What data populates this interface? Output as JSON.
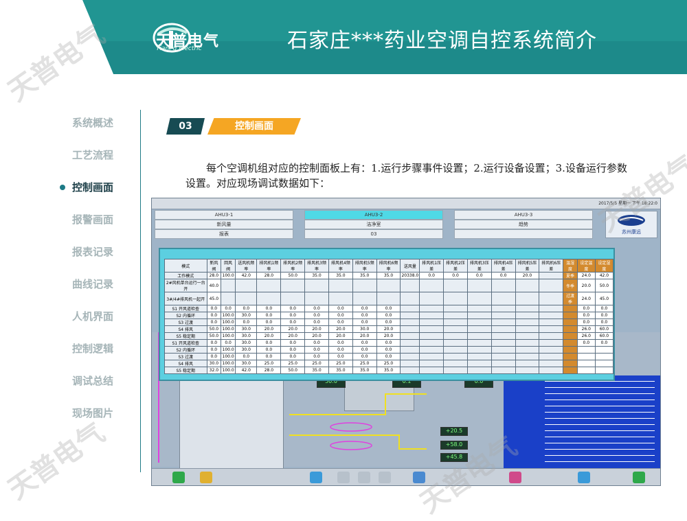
{
  "header": {
    "logo_text": "天普电气",
    "logo_sub": "TianPu Electric",
    "title": "石家庄***药业空调自控系统简介"
  },
  "sidebar": {
    "items": [
      {
        "label": "系统概述",
        "active": false
      },
      {
        "label": "工艺流程",
        "active": false
      },
      {
        "label": "控制画面",
        "active": true
      },
      {
        "label": "报警画面",
        "active": false
      },
      {
        "label": "报表记录",
        "active": false
      },
      {
        "label": "曲线记录",
        "active": false
      },
      {
        "label": "人机界面",
        "active": false
      },
      {
        "label": "控制逻辑",
        "active": false
      },
      {
        "label": "调试总结",
        "active": false
      },
      {
        "label": "现场图片",
        "active": false
      }
    ]
  },
  "section": {
    "number": "03",
    "title": "控制画面"
  },
  "paragraph": "每个空调机组对应的控制面板上有：1.运行步骤事件设置；2.运行设备设置；3.设备运行参数设置。对应现场调试数据如下：",
  "screenshot": {
    "clock": "2017/5/5 星期一 下午 18:22:0",
    "units": [
      "AHU3-1",
      "AHU3-2",
      "AHU3-3"
    ],
    "row2": [
      "新风量",
      "洁净室",
      "趋势"
    ],
    "row3": [
      "报表",
      "03",
      ""
    ],
    "brand": "苏州康远",
    "readouts": [
      "50.0",
      "0.1",
      "0.0"
    ],
    "temps": [
      "+20.5",
      "+58.0",
      "+45.8"
    ],
    "table_header": [
      "模式",
      "新风阀",
      "回风阀",
      "送风机频率",
      "排风机1频率",
      "排风机2频率",
      "排风机3频率",
      "排风机4频率",
      "排风机5频率",
      "排风机6频率",
      "送风量",
      "排风机1压差",
      "排风机2压差",
      "排风机3压差",
      "排风机4压差",
      "排风机5压差",
      "排风机6压差"
    ],
    "table_rows": [
      [
        "工作模式",
        "28.0",
        "100.0",
        "42.0",
        "28.0",
        "50.0",
        "35.0",
        "35.0",
        "35.0",
        "35.0",
        "20338.0",
        "0.0",
        "0.0",
        "0.0",
        "0.0",
        "20.0"
      ],
      [
        "2#风机单台运行一台开",
        "40.0"
      ],
      [
        "3#/4#排风机一起开",
        "45.0"
      ],
      [
        "S1 开风道检查",
        "0.0",
        "0.0",
        "0.0",
        "0.0",
        "0.0",
        "0.0",
        "0.0",
        "0.0",
        "0.0"
      ],
      [
        "S2 内循环",
        "0.0",
        "100.0",
        "30.0",
        "0.0",
        "0.0",
        "0.0",
        "0.0",
        "0.0",
        "0.0"
      ],
      [
        "S3 过渡",
        "0.0",
        "100.0",
        "0.0",
        "0.0",
        "0.0",
        "0.0",
        "0.0",
        "0.0",
        "0.0"
      ],
      [
        "S4 排风",
        "50.0",
        "100.0",
        "30.0",
        "20.0",
        "20.0",
        "20.0",
        "20.0",
        "30.0",
        "20.0"
      ],
      [
        "S5 稳定期",
        "50.0",
        "100.0",
        "30.0",
        "20.0",
        "20.0",
        "20.0",
        "20.0",
        "20.0",
        "20.0"
      ],
      [
        "S1 开风道检查",
        "0.0",
        "0.0",
        "30.0",
        "0.0",
        "0.0",
        "0.0",
        "0.0",
        "0.0",
        "0.0"
      ],
      [
        "S2 内循环",
        "0.0",
        "100.0",
        "30.0",
        "0.0",
        "0.0",
        "0.0",
        "0.0",
        "0.0",
        "0.0"
      ],
      [
        "S3 过渡",
        "0.0",
        "100.0",
        "0.0",
        "0.0",
        "0.0",
        "0.0",
        "0.0",
        "0.0",
        "0.0"
      ],
      [
        "S4 排风",
        "30.0",
        "100.0",
        "30.0",
        "25.0",
        "25.0",
        "25.0",
        "25.0",
        "25.0",
        "25.0"
      ],
      [
        "S5 稳定期",
        "32.0",
        "100.0",
        "42.0",
        "28.0",
        "50.0",
        "35.0",
        "35.0",
        "35.0",
        "35.0"
      ]
    ],
    "right_col": [
      "24.0",
      "42.0",
      "20.0",
      "50.0",
      "24.0",
      "45.0",
      "0.0",
      "0.0",
      "0.0",
      "0.0",
      "0.0",
      "0.0",
      "26.0",
      "60.0",
      "26.0",
      "60.0",
      "0.0",
      "0.0"
    ],
    "right_head": [
      "温湿度",
      "设定温度",
      "设定湿度"
    ],
    "right_labels": [
      "夏季",
      "冬季",
      "过渡季"
    ]
  },
  "colors": {
    "teal": "#1d7a86",
    "dark_teal": "#174b53",
    "orange": "#f5a623",
    "active_text": "#1d3f48",
    "inactive_text": "#a6b5b8"
  }
}
